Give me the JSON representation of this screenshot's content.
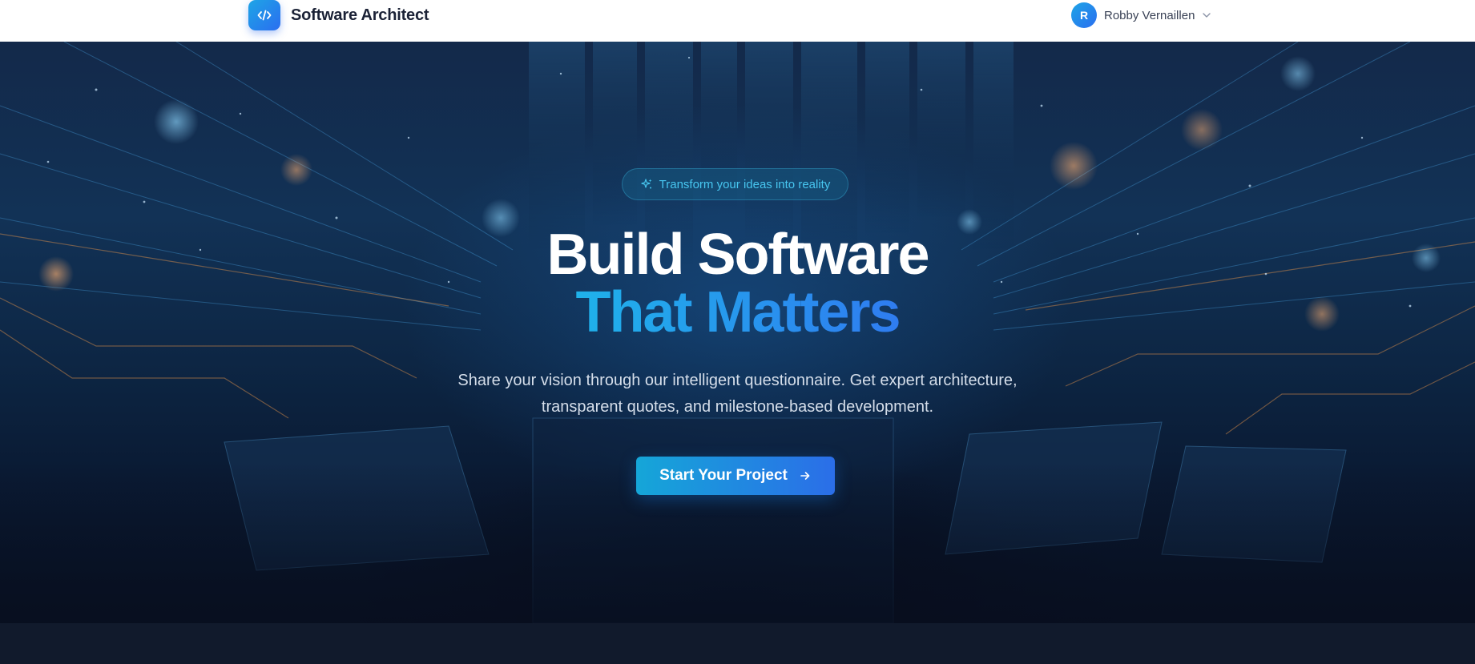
{
  "header": {
    "brand_title": "Software Architect",
    "brand_icon": "code-icon",
    "user": {
      "initial": "R",
      "name": "Robby Vernaillen",
      "menu_icon": "chevron-down-icon"
    }
  },
  "hero": {
    "badge_icon": "sparkles-icon",
    "badge_text": "Transform your ideas into reality",
    "title_line1": "Build Software",
    "title_line2": "That Matters",
    "subtitle": "Share your vision through our intelligent questionnaire. Get expert architecture, transparent quotes, and milestone-based development.",
    "cta_label": "Start Your Project",
    "cta_icon": "arrow-right-icon"
  },
  "colors": {
    "accent": "#1ea5e6",
    "accent_end": "#2a6ef0",
    "header_bg": "#ffffff",
    "hero_bg": "#0d2644",
    "page_bg": "#111a2c"
  }
}
